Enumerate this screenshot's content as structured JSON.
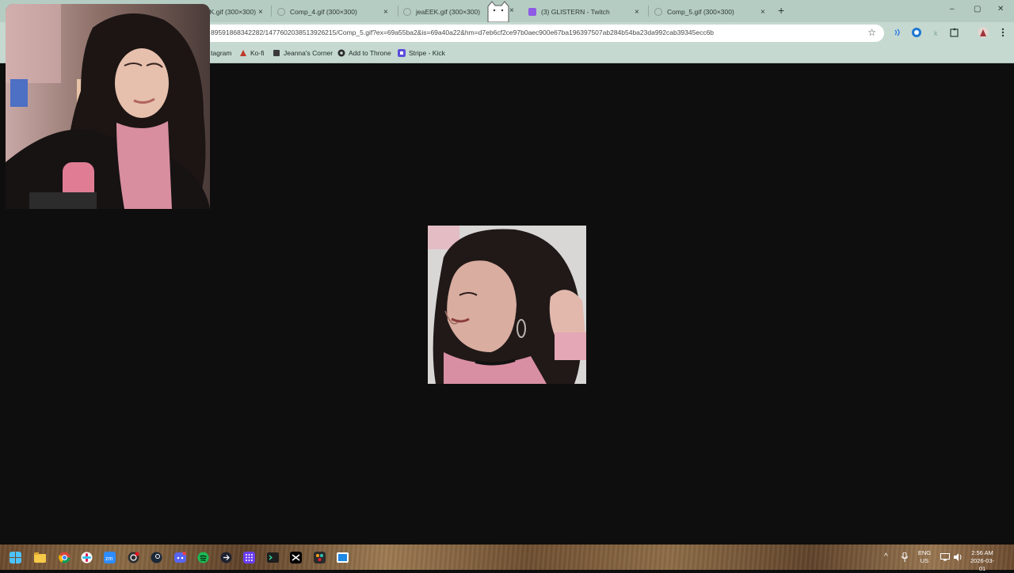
{
  "browser": {
    "tabs": [
      {
        "label": "jeaEEK.gif (300×300)"
      },
      {
        "label": "Comp_4.gif (300×300)"
      },
      {
        "label": "jeaEEK.gif (300×300)"
      },
      {
        "label": "(3) GLISTERN - Twitch"
      },
      {
        "label": "Comp_5.gif (300×300)"
      }
    ],
    "url": "89591868342282/1477602038513926215/Comp_5.gif?ex=69a55ba2&is=69a40a22&hm=d7eb6cf2ce97b0aec900e67ba196397507ab284b54ba23da992cab39345ecc6b",
    "bookmarks": [
      {
        "label": "tagram"
      },
      {
        "label": "Ko-fi"
      },
      {
        "label": "Jeanna's Corner"
      },
      {
        "label": "Add to Throne"
      },
      {
        "label": "Stripe - Kick"
      }
    ],
    "icons": {
      "new_tab": "+",
      "close": "×",
      "star": "☆",
      "minimize": "–",
      "maximize": "▢",
      "window_close": "✕"
    }
  },
  "taskbar": {
    "language": "ENG",
    "region": "US",
    "time": "2:56 AM",
    "date": "2026-03-01"
  },
  "colors": {
    "page_bg": "#0e0e0e",
    "chrome_bg": "#c5d9d1",
    "tab_bg": "#b5ccc3"
  }
}
